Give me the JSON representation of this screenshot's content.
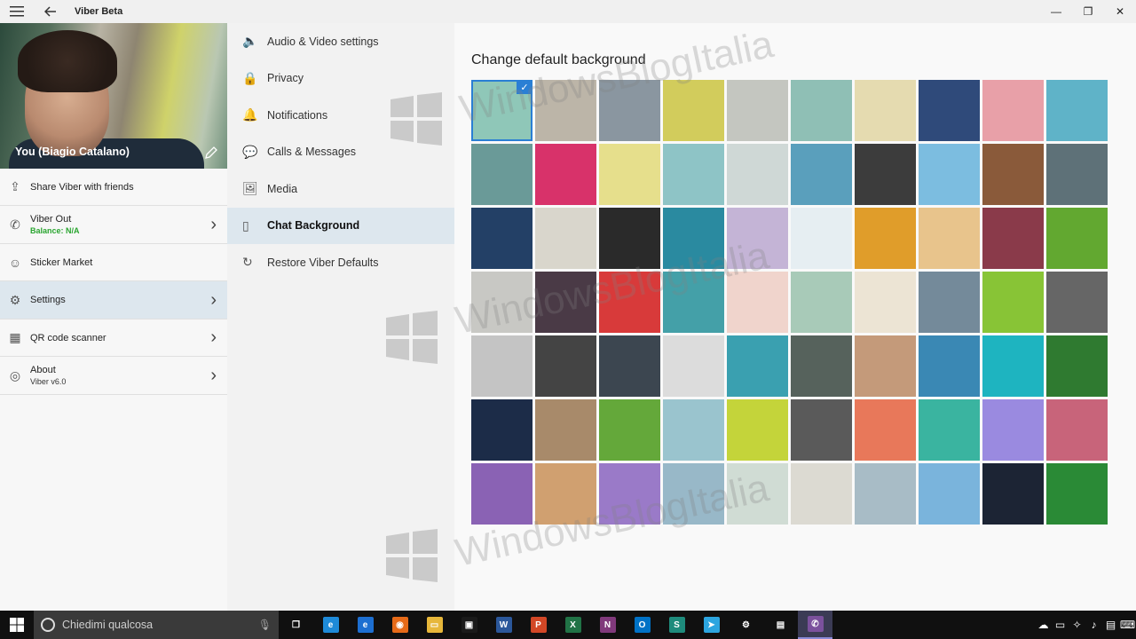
{
  "window": {
    "title": "Viber Beta"
  },
  "profile": {
    "name": "You (Biagio Catalano)"
  },
  "left_menu": [
    {
      "label": "Share Viber with friends",
      "sub": "",
      "icon": "share-icon",
      "chevron": false,
      "active": false
    },
    {
      "label": "Viber Out",
      "sub": "Balance: N/A",
      "icon": "phone-icon",
      "chevron": true,
      "active": false
    },
    {
      "label": "Sticker Market",
      "sub": "",
      "icon": "sticker-icon",
      "chevron": false,
      "active": false
    },
    {
      "label": "Settings",
      "sub": "",
      "icon": "gear-icon",
      "chevron": true,
      "active": true
    },
    {
      "label": "QR code scanner",
      "sub": "",
      "icon": "qr-icon",
      "chevron": true,
      "active": false
    },
    {
      "label": "About",
      "sub": "Viber v6.0",
      "icon": "viber-icon",
      "chevron": true,
      "active": false
    }
  ],
  "settings_menu": [
    {
      "label": "Audio & Video settings",
      "icon": "speaker-icon"
    },
    {
      "label": "Privacy",
      "icon": "lock-icon"
    },
    {
      "label": "Notifications",
      "icon": "bell-icon"
    },
    {
      "label": "Calls & Messages",
      "icon": "chat-icon"
    },
    {
      "label": "Media",
      "icon": "image-icon"
    },
    {
      "label": "Chat Background",
      "icon": "mobile-icon",
      "active": true
    },
    {
      "label": "Restore Viber Defaults",
      "icon": "restore-icon"
    }
  ],
  "content": {
    "title": "Change default background",
    "selected_index": 0,
    "backgrounds": [
      "#8fc7b8",
      "#bcb5a8",
      "#8a96a0",
      "#d2cc5c",
      "#c4c6c0",
      "#8fbfb5",
      "#e5dbb0",
      "#2f4a7a",
      "#e8a0a8",
      "#5fb3c8",
      "#6a9a98",
      "#d8326a",
      "#e6df8c",
      "#8ec4c6",
      "#cfd8d6",
      "#5a9fbc",
      "#3c3c3c",
      "#7cbde0",
      "#8a5a3a",
      "#5e7178",
      "#234066",
      "#d9d6cc",
      "#2a2a2a",
      "#2a8aa0",
      "#c4b4d6",
      "#e6eef2",
      "#e09d2a",
      "#e8c48c",
      "#8a3a4a",
      "#62a830",
      "#c8c8c4",
      "#4a3a46",
      "#d83a3a",
      "#44a0a8",
      "#f0d4cc",
      "#a8cab8",
      "#ece4d4",
      "#748a9a",
      "#88c436",
      "#666666",
      "#c4c4c4",
      "#444444",
      "#3c4650",
      "#dcdcdc",
      "#3aa0b0",
      "#56625c",
      "#c49a7a",
      "#3a88b4",
      "#1eb4c0",
      "#2f7a30",
      "#1c2c48",
      "#a88a6a",
      "#64a83a",
      "#9ac4ce",
      "#c4d43a",
      "#5a5a5a",
      "#e8785a",
      "#3ab4a0",
      "#9a8ae0",
      "#c8647a",
      "#8a62b4",
      "#d0a070",
      "#9a7ac8",
      "#98b8c8",
      "#d0dcd4",
      "#dcdad2",
      "#a8bcc6",
      "#7ab4dc",
      "#1c2434",
      "#2a8a36"
    ]
  },
  "watermark": {
    "text": "WindowsBlogItalia"
  },
  "taskbar": {
    "search_placeholder": "Chiedimi qualcosa",
    "apps": [
      {
        "icon": "task-view-icon",
        "color": "#101010",
        "glyph": "❐"
      },
      {
        "icon": "internet-explorer-icon",
        "color": "#1e8ad8",
        "glyph": "e"
      },
      {
        "icon": "edge-icon",
        "color": "#1d6fd1",
        "glyph": "e"
      },
      {
        "icon": "firefox-icon",
        "color": "#e66a18",
        "glyph": "◉"
      },
      {
        "icon": "file-explorer-icon",
        "color": "#e7b73a",
        "glyph": "▭"
      },
      {
        "icon": "store-icon",
        "color": "#1a1a1a",
        "glyph": "▣"
      },
      {
        "icon": "word-icon",
        "color": "#2b579a",
        "glyph": "W"
      },
      {
        "icon": "powerpoint-icon",
        "color": "#d24726",
        "glyph": "P"
      },
      {
        "icon": "excel-icon",
        "color": "#217346",
        "glyph": "X"
      },
      {
        "icon": "onenote-icon",
        "color": "#80397b",
        "glyph": "N"
      },
      {
        "icon": "outlook-icon",
        "color": "#0072c6",
        "glyph": "O"
      },
      {
        "icon": "sway-icon",
        "color": "#1e8b7c",
        "glyph": "S"
      },
      {
        "icon": "telegram-icon",
        "color": "#2ca5e0",
        "glyph": "➤"
      },
      {
        "icon": "settings-icon",
        "color": "#101010",
        "glyph": "⚙"
      },
      {
        "icon": "windows-store-bag-icon",
        "color": "#101010",
        "glyph": "▤"
      },
      {
        "icon": "viber-app-icon",
        "color": "#7b519d",
        "glyph": "✆",
        "active": true
      }
    ],
    "tray": [
      {
        "icon": "cloud-icon",
        "glyph": "☁"
      },
      {
        "icon": "battery-icon",
        "glyph": "▭"
      },
      {
        "icon": "network-icon",
        "glyph": "✧"
      },
      {
        "icon": "volume-icon",
        "glyph": "♪"
      },
      {
        "icon": "notifications-icon",
        "glyph": "▤"
      },
      {
        "icon": "keyboard-icon",
        "glyph": "⌨"
      }
    ]
  }
}
